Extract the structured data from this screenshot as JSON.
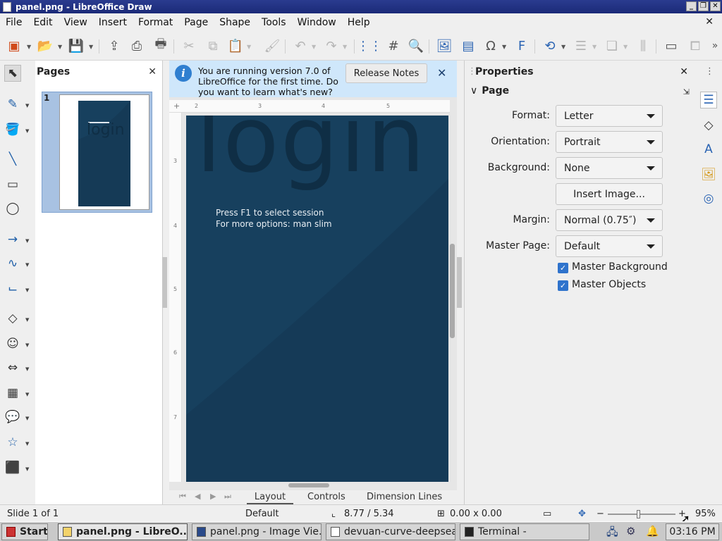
{
  "window": {
    "title": "panel.png - LibreOffice Draw"
  },
  "menu": [
    "File",
    "Edit",
    "View",
    "Insert",
    "Format",
    "Page",
    "Shape",
    "Tools",
    "Window",
    "Help"
  ],
  "pages_panel": {
    "title": "Pages",
    "thumbnail_number": "1"
  },
  "infobar": {
    "message": "You are running version 7.0 of LibreOffice for the first time. Do you want to learn what's new?",
    "button": "Release Notes"
  },
  "page_content": {
    "big_text": "login",
    "line1": "Press F1 to select session",
    "line2": "For more options: man slim",
    "background_color": "#17405e"
  },
  "ruler": {
    "h_ticks": [
      "2",
      "3",
      "4",
      "5"
    ],
    "v_ticks": [
      "3",
      "4",
      "5",
      "6",
      "7"
    ]
  },
  "tabs": [
    "Layout",
    "Controls",
    "Dimension Lines"
  ],
  "properties": {
    "title": "Properties",
    "section": "Page",
    "format_label": "Format:",
    "format_value": "Letter",
    "orientation_label": "Orientation:",
    "orientation_value": "Portrait",
    "background_label": "Background:",
    "background_value": "None",
    "insert_image": "Insert Image...",
    "margin_label": "Margin:",
    "margin_value": "Normal (0.75″)",
    "master_page_label": "Master Page:",
    "master_page_value": "Default",
    "master_background": "Master Background",
    "master_objects": "Master Objects"
  },
  "status": {
    "slide": "Slide 1 of 1",
    "layout": "Default",
    "position": "8.77 / 5.34",
    "size": "0.00 x 0.00",
    "zoom": "95%"
  },
  "taskbar": {
    "start": "Start",
    "tasks": [
      "panel.png - LibreO...",
      "panel.png - Image Vie...",
      "devuan-curve-deepsea",
      "Terminal -"
    ],
    "clock": "03:16 PM"
  }
}
